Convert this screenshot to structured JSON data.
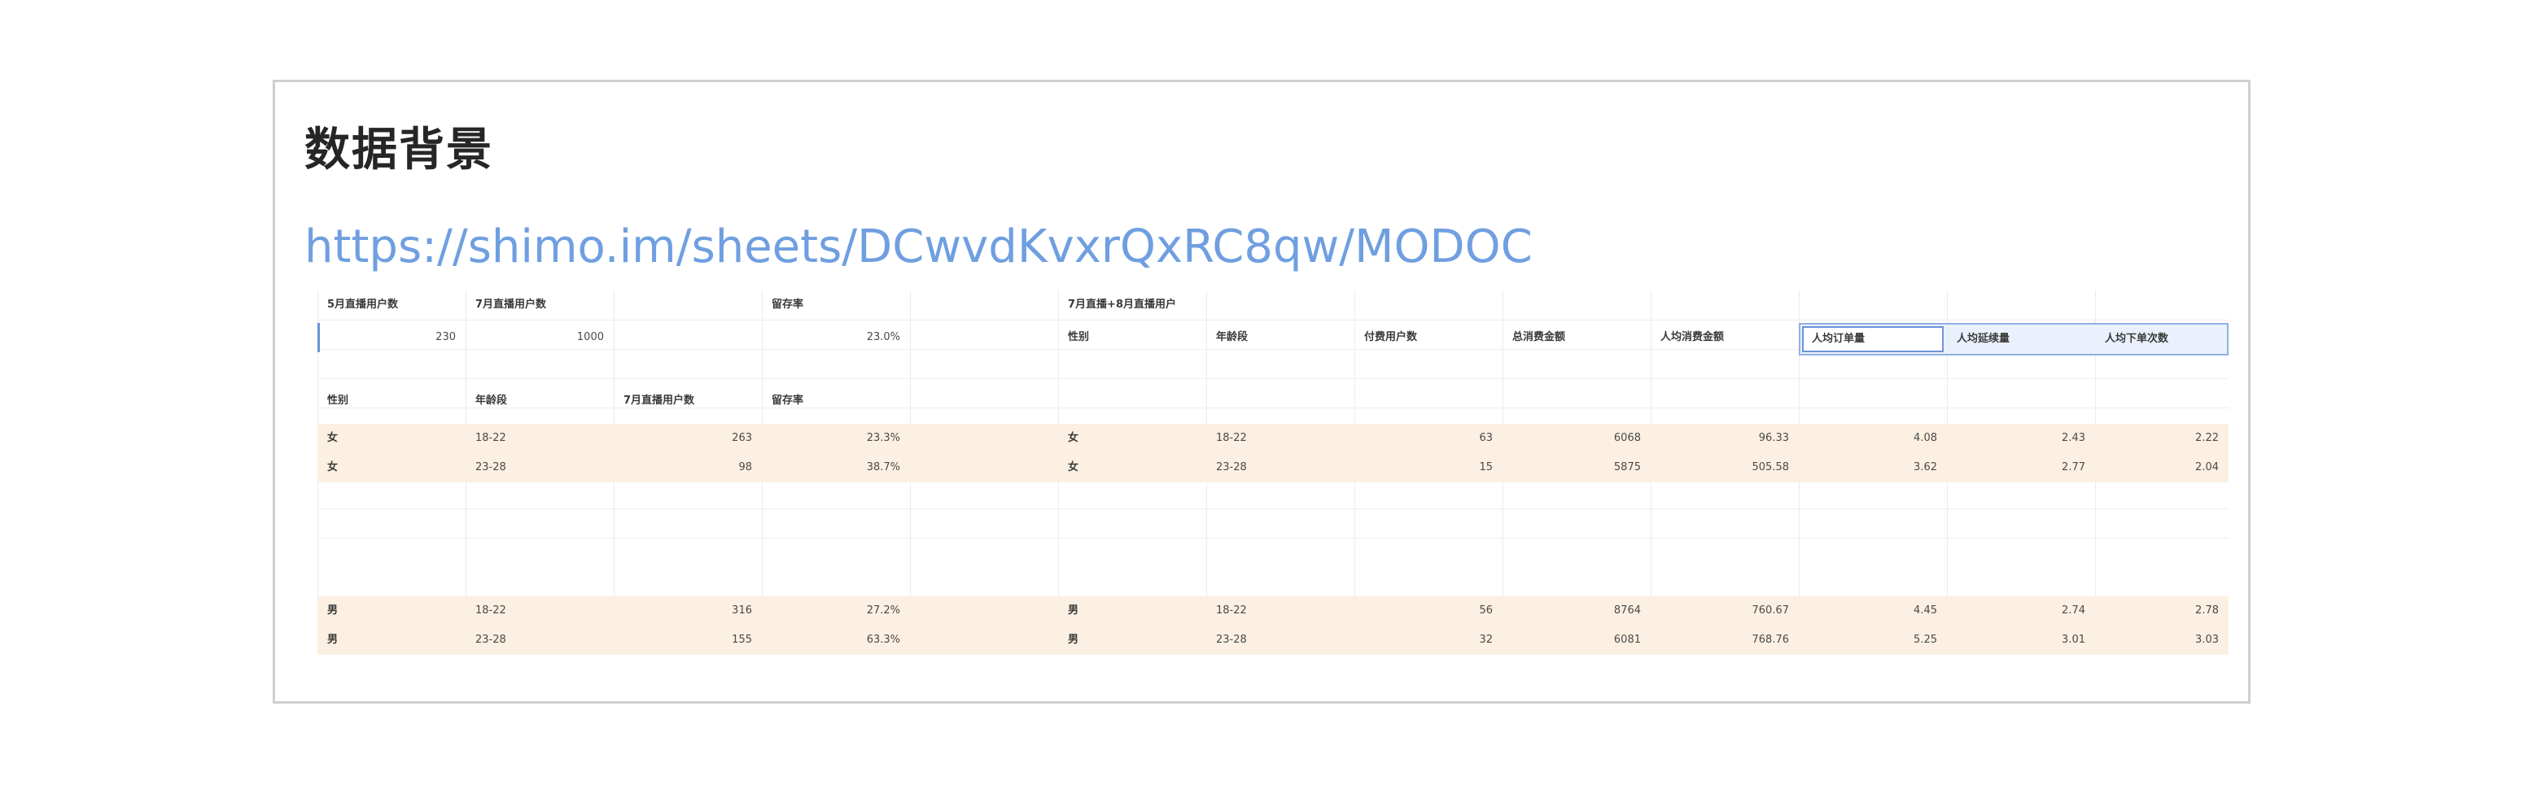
{
  "heading": "数据背景",
  "link": "https://shimo.im/sheets/DCwvdKvxrQxRC8qw/MODOC",
  "sheet": {
    "top_headers": [
      "5月直播用户数",
      "7月直播用户数",
      "",
      "留存率",
      "",
      "7月直播+8月直播用户"
    ],
    "top_values": [
      "230",
      "1000",
      "",
      "23.0%"
    ],
    "right_headers": [
      "性别",
      "年龄段",
      "付费用户数",
      "总消费金额",
      "人均消费金额",
      "人均订单量",
      "人均延续量",
      "人均下单次数"
    ],
    "left_headers": [
      "性别",
      "年龄段",
      "7月直播用户数",
      "留存率"
    ],
    "left_rows": [
      {
        "gender": "女",
        "age": "18-22",
        "users": "263",
        "rate": "23.3%"
      },
      {
        "gender": "女",
        "age": "23-28",
        "users": "98",
        "rate": "38.7%"
      },
      {
        "gender": "男",
        "age": "18-22",
        "users": "316",
        "rate": "27.2%"
      },
      {
        "gender": "男",
        "age": "23-28",
        "users": "155",
        "rate": "63.3%"
      }
    ],
    "right_rows": [
      {
        "gender": "女",
        "age": "18-22",
        "payers": "63",
        "total": "6068",
        "avg": "96.33",
        "orders": "4.08",
        "cont": "2.43",
        "times": "2.22"
      },
      {
        "gender": "女",
        "age": "23-28",
        "payers": "15",
        "total": "5875",
        "avg": "505.58",
        "orders": "3.62",
        "cont": "2.77",
        "times": "2.04"
      },
      {
        "gender": "男",
        "age": "18-22",
        "payers": "56",
        "total": "8764",
        "avg": "760.67",
        "orders": "4.45",
        "cont": "2.74",
        "times": "2.78"
      },
      {
        "gender": "男",
        "age": "23-28",
        "payers": "32",
        "total": "6081",
        "avg": "768.76",
        "orders": "5.25",
        "cont": "3.01",
        "times": "3.03"
      }
    ]
  }
}
